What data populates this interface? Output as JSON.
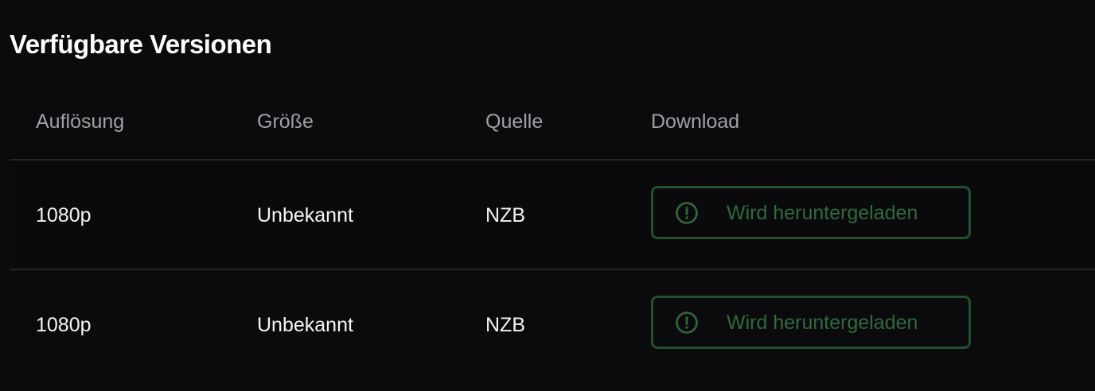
{
  "section": {
    "title": "Verfügbare Versionen"
  },
  "table": {
    "headers": {
      "resolution": "Auflösung",
      "size": "Größe",
      "source": "Quelle",
      "download": "Download"
    },
    "rows": [
      {
        "resolution": "1080p",
        "size": "Unbekannt",
        "source": "NZB",
        "download_label": "Wird heruntergeladen",
        "download_icon": "alert-circle-icon"
      },
      {
        "resolution": "1080p",
        "size": "Unbekannt",
        "source": "NZB",
        "download_label": "Wird heruntergeladen",
        "download_icon": "alert-circle-icon"
      }
    ]
  },
  "colors": {
    "background": "#0b0b0d",
    "header_text": "#a0a1a6",
    "cell_text": "#f4f4f5",
    "download_border": "#22502c",
    "download_text": "#2e6b3c",
    "divider": "#25262a"
  }
}
